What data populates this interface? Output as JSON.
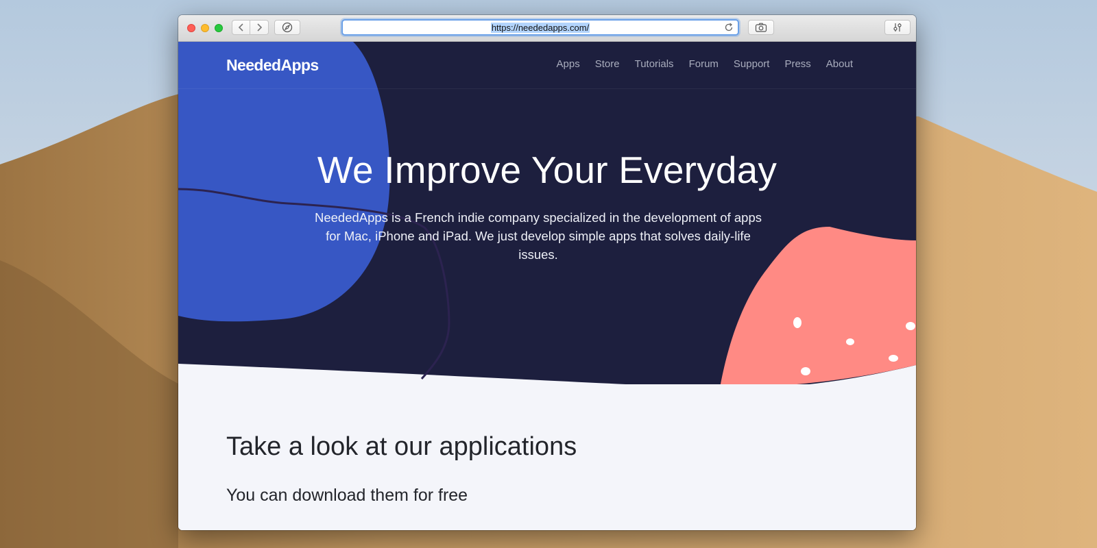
{
  "browser": {
    "url": "https://neededapps.com/",
    "accent": "#6aa0e8"
  },
  "site": {
    "logo": "NeededApps",
    "nav": [
      "Apps",
      "Store",
      "Tutorials",
      "Forum",
      "Support",
      "Press",
      "About"
    ],
    "hero": {
      "title": "We Improve Your Everyday",
      "text": "NeededApps is a French indie company specialized in the development of apps for Mac, iPhone and iPad. We just develop simple apps that solves daily-life issues."
    },
    "section": {
      "title": "Take a look at our applications",
      "subtitle": "You can download them for free"
    },
    "colors": {
      "hero_bg": "#1d1f3e",
      "blue_blob": "#3757c4",
      "coral_blob": "#ff8a84",
      "page_bg": "#f4f5fa"
    }
  },
  "icons": [
    "back-icon",
    "forward-icon",
    "compass-icon",
    "reload-icon",
    "camera-icon",
    "settings-sliders-icon"
  ]
}
